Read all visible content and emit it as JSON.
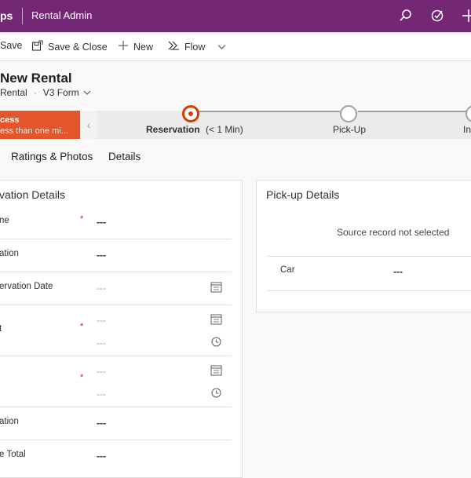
{
  "topbar": {
    "app_name_fragment": "ps",
    "area": "Rental Admin",
    "icons": [
      "search-icon",
      "assistant-target-icon",
      "add-icon"
    ]
  },
  "commandbar": {
    "save_label": "Save",
    "save_close_label": "Save & Close",
    "new_label": "New",
    "flow_label": "Flow"
  },
  "header": {
    "title": "New Rental",
    "entity": "Rental",
    "form_name": "V3 Form"
  },
  "bpf": {
    "active_stage_name": "cess",
    "active_stage_duration": "ess than one mi...",
    "stages": [
      {
        "label": "Reservation",
        "duration": "(< 1 Min)"
      },
      {
        "label": "Pick-Up"
      },
      {
        "label": "In"
      }
    ]
  },
  "tabs": [
    "Ratings & Photos",
    "Details"
  ],
  "reservation": {
    "title": "vation Details",
    "fields": [
      {
        "label": "ne",
        "required": "*",
        "value": "---"
      },
      {
        "label": "ation",
        "value": "---"
      },
      {
        "label": "ervation Date",
        "value": "---"
      },
      {
        "label": "t",
        "required": "*",
        "date": "---",
        "time": "---"
      },
      {
        "label": "",
        "required": "*",
        "date": "---",
        "time": "---"
      },
      {
        "label": "ation",
        "value": "---"
      },
      {
        "label": "e Total",
        "value": "---"
      }
    ]
  },
  "pickup": {
    "title": "Pick-up Details",
    "source_msg": "Source record not selected",
    "car_label": "Car",
    "car_value": "---"
  },
  "colors": {
    "brand": "#742774",
    "active_stage": "#e3552a",
    "ring": "#d83b01"
  }
}
